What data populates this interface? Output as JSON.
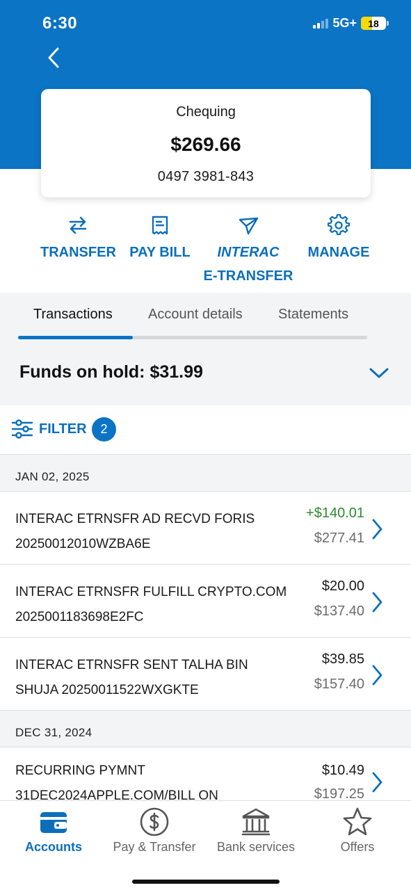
{
  "status_bar": {
    "time": "6:30",
    "network": "5G+",
    "battery": "18"
  },
  "account": {
    "name": "Chequing",
    "balance": "$269.66",
    "number": "0497 3981-843"
  },
  "actions": [
    {
      "label": "TRANSFER",
      "icon": "transfer-icon"
    },
    {
      "label": "PAY BILL",
      "icon": "receipt-icon"
    },
    {
      "label_line1": "INTERAC",
      "label_line2": "E-TRANSFER",
      "icon": "send-icon"
    },
    {
      "label": "MANAGE",
      "icon": "gear-icon"
    }
  ],
  "tabs": [
    {
      "label": "Transactions",
      "active": true
    },
    {
      "label": "Account details",
      "active": false
    },
    {
      "label": "Statements",
      "active": false
    }
  ],
  "funds_on_hold": "Funds on hold: $31.99",
  "filter": {
    "label": "FILTER",
    "count": "2"
  },
  "groups": [
    {
      "date": "JAN 02, 2025",
      "transactions": [
        {
          "line1": "INTERAC ETRNSFR AD RECVD FORIS",
          "line2": "20250012010WZBA6E",
          "amount": "+$140.01",
          "balance": "$277.41",
          "credit": true
        },
        {
          "line1": "INTERAC ETRNSFR FULFILL CRYPTO.COM",
          "line2": "2025001183698E2FC",
          "amount": "$20.00",
          "balance": "$137.40",
          "credit": false
        },
        {
          "line1": "INTERAC ETRNSFR SENT TALHA BIN",
          "line2": "SHUJA 20250011522WXGKTE",
          "amount": "$39.85",
          "balance": "$157.40",
          "credit": false
        }
      ]
    },
    {
      "date": "DEC 31, 2024",
      "transactions": [
        {
          "line1": "RECURRING PYMNT",
          "line2": "31DEC2024APPLE.COM/BILL ON",
          "amount": "$10.49",
          "balance": "$197.25",
          "credit": false
        }
      ]
    }
  ],
  "bottom_nav": [
    {
      "label": "Accounts",
      "icon": "wallet-icon",
      "active": true
    },
    {
      "label": "Pay & Transfer",
      "icon": "dollar-circle-icon",
      "active": false
    },
    {
      "label": "Bank services",
      "icon": "bank-icon",
      "active": false
    },
    {
      "label": "Offers",
      "icon": "star-icon",
      "active": false
    }
  ],
  "colors": {
    "brand": "#0b74c4",
    "credit": "#2e8b2e"
  }
}
